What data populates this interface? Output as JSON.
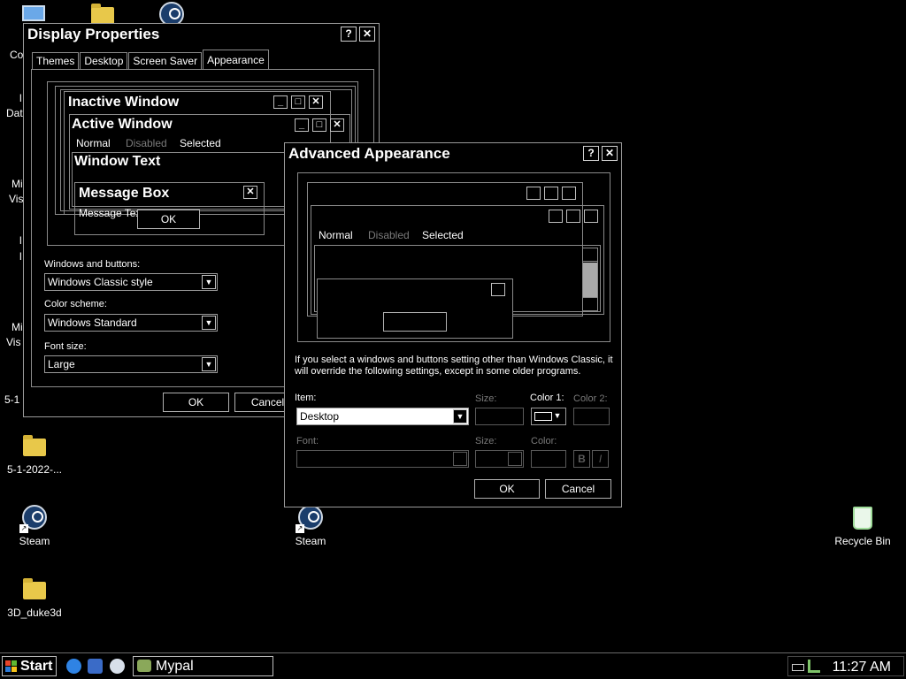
{
  "desktop": {
    "icons": [
      {
        "label": "Steam"
      },
      {
        "label": "Steam"
      },
      {
        "label": "Recycle Bin"
      },
      {
        "label": "5-1-2022-..."
      },
      {
        "label": "3D_duke3d"
      }
    ],
    "partial_labels": [
      "Co",
      "l",
      "Dat",
      "Mi",
      "Vis",
      "l",
      "l",
      "Mi",
      "Vis",
      "5-1"
    ]
  },
  "display_properties": {
    "title": "Display Properties",
    "help": "?",
    "close": "✕",
    "tabs": [
      "Themes",
      "Desktop",
      "Screen Saver",
      "Appearance"
    ],
    "active_tab": "Appearance",
    "preview": {
      "inactive_window": "Inactive Window",
      "active_window": "Active Window",
      "menu_normal": "Normal",
      "menu_disabled": "Disabled",
      "menu_selected": "Selected",
      "window_text": "Window Text",
      "message_box": "Message Box",
      "message_text": "Message Text",
      "ok": "OK"
    },
    "windows_buttons_label": "Windows and buttons:",
    "windows_buttons_value": "Windows Classic style",
    "color_scheme_label": "Color scheme:",
    "color_scheme_value": "Windows Standard",
    "font_size_label": "Font size:",
    "font_size_value": "Large",
    "ok": "OK",
    "cancel": "Cancel"
  },
  "advanced": {
    "title": "Advanced Appearance",
    "help": "?",
    "close": "✕",
    "preview": {
      "menu_normal": "Normal",
      "menu_disabled": "Disabled",
      "menu_selected": "Selected"
    },
    "info": "If you select a windows and buttons setting other than Windows Classic, it will override the following settings, except in some older programs.",
    "item_label": "Item:",
    "item_value": "Desktop",
    "size_label": "Size:",
    "color1_label": "Color 1:",
    "color2_label": "Color 2:",
    "font_label": "Font:",
    "font_size_label": "Size:",
    "font_color_label": "Color:",
    "bold": "B",
    "italic": "I",
    "ok": "OK",
    "cancel": "Cancel"
  },
  "taskbar": {
    "start": "Start",
    "task_label": "Mypal",
    "time": "11:27 AM"
  },
  "colors": {
    "background": "#000000",
    "border": "#9a9a9a",
    "disabled": "#7a7a7a",
    "folder": "#e8c84a"
  }
}
